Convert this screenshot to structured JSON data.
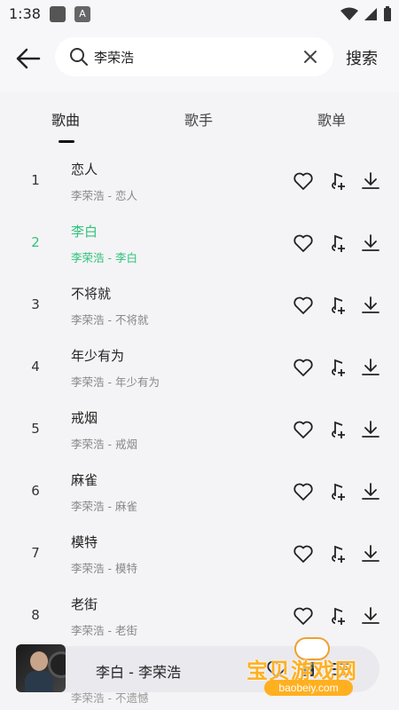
{
  "status_bar": {
    "time": "1:38"
  },
  "header": {
    "search_value": "李荣浩",
    "search_button": "搜索"
  },
  "tabs": [
    {
      "label": "歌曲",
      "active": true
    },
    {
      "label": "歌手",
      "active": false
    },
    {
      "label": "歌单",
      "active": false
    }
  ],
  "songs": [
    {
      "num": "1",
      "title": "恋人",
      "subtitle": "李荣浩 - 恋人"
    },
    {
      "num": "2",
      "title": "李白",
      "subtitle": "李荣浩 - 李白",
      "active": true
    },
    {
      "num": "3",
      "title": "不将就",
      "subtitle": "李荣浩 - 不将就"
    },
    {
      "num": "4",
      "title": "年少有为",
      "subtitle": "李荣浩 - 年少有为"
    },
    {
      "num": "5",
      "title": "戒烟",
      "subtitle": "李荣浩 - 戒烟"
    },
    {
      "num": "6",
      "title": "麻雀",
      "subtitle": "李荣浩 - 麻雀"
    },
    {
      "num": "7",
      "title": "模特",
      "subtitle": "李荣浩 - 模特"
    },
    {
      "num": "8",
      "title": "老街",
      "subtitle": "李荣浩 - 老街"
    }
  ],
  "partial_row_subtitle": "李荣浩 - 不遗憾",
  "player": {
    "now_playing": "李白 - 李荣浩"
  },
  "watermark": {
    "text": "宝贝游戏网",
    "url": "baobeiy.com"
  },
  "colors": {
    "accent": "#31c27c",
    "background": "#f4f4f6"
  }
}
